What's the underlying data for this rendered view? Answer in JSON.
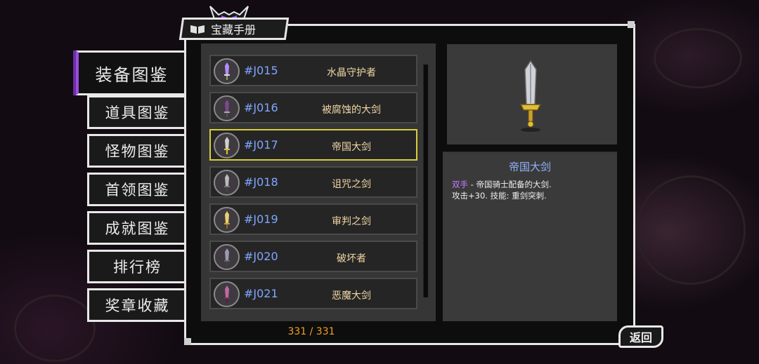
{
  "menu": {
    "items": [
      {
        "label": "装备图鉴",
        "active": true
      },
      {
        "label": "道具图鉴",
        "active": false
      },
      {
        "label": "怪物图鉴",
        "active": false
      },
      {
        "label": "首领图鉴",
        "active": false
      },
      {
        "label": "成就图鉴",
        "active": false
      },
      {
        "label": "排行榜",
        "active": false
      },
      {
        "label": "奖章收藏",
        "active": false
      }
    ]
  },
  "panel": {
    "title": "宝藏手册",
    "title_icon": "book-icon"
  },
  "list": {
    "rows": [
      {
        "code": "#J015",
        "name": "水晶守护者",
        "icon": "crystal-sword-icon",
        "selected": false
      },
      {
        "code": "#J016",
        "name": "被腐蚀的大剑",
        "icon": "corroded-sword-icon",
        "selected": false
      },
      {
        "code": "#J017",
        "name": "帝国大剑",
        "icon": "imperial-sword-icon",
        "selected": true
      },
      {
        "code": "#J018",
        "name": "诅咒之剑",
        "icon": "cursed-sword-icon",
        "selected": false
      },
      {
        "code": "#J019",
        "name": "审判之剑",
        "icon": "judgement-sword-icon",
        "selected": false
      },
      {
        "code": "#J020",
        "name": "破坏者",
        "icon": "destroyer-sword-icon",
        "selected": false
      },
      {
        "code": "#J021",
        "name": "恶魔大剑",
        "icon": "demon-sword-icon",
        "selected": false
      }
    ],
    "counter": "331 / 331"
  },
  "detail": {
    "title": "帝国大剑",
    "type_label": "双手",
    "line1_rest": " - 帝国骑士配备的大剑.",
    "line2": "攻击+30. 技能: 重剑突刺."
  },
  "back_button": {
    "label": "返回"
  },
  "colors": {
    "accent_purple": "#9b4ddb",
    "selected_border": "#d7cd3a",
    "code_blue": "#7fa6ff",
    "name_gold": "#f1d7a5",
    "counter_orange": "#f0a020"
  }
}
